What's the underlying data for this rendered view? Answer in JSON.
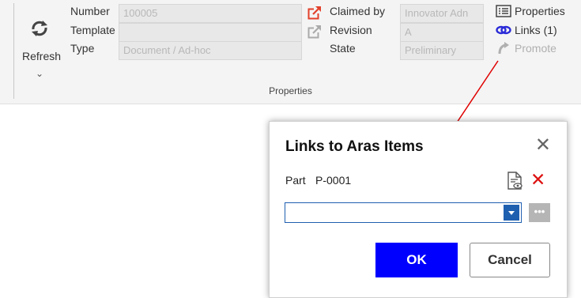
{
  "ribbon": {
    "refresh_label": "Refresh",
    "refresh_chevron": "⌄",
    "group_caption": "Properties",
    "fields": {
      "number": {
        "label": "Number",
        "value": "100005"
      },
      "template": {
        "label": "Template",
        "value": ""
      },
      "type": {
        "label": "Type",
        "value": "Document / Ad-hoc"
      },
      "claimed_by": {
        "label": "Claimed by",
        "value": "Innovator Adn"
      },
      "revision": {
        "label": "Revision",
        "value": "A"
      },
      "state": {
        "label": "State",
        "value": "Preliminary"
      }
    },
    "buttons": {
      "properties": "Properties",
      "links": "Links (1)",
      "promote": "Promote"
    }
  },
  "dialog": {
    "title": "Links to Aras Items",
    "close_glyph": "✕",
    "link_item": {
      "type": "Part",
      "value": "P-0001"
    },
    "delete_glyph": "✕",
    "combo_value": "",
    "ellipsis": "•••",
    "ok_label": "OK",
    "cancel_label": "Cancel"
  },
  "colors": {
    "accent_blue": "#0000ff",
    "combo_blue": "#1f5fb0",
    "external_link_red": "#e2402a",
    "arrow_red": "#e00000",
    "delete_red": "#dd1111"
  },
  "icons": [
    "refresh-icon",
    "external-link-icon",
    "list-icon",
    "links-icon",
    "promote-icon",
    "document-preview-icon",
    "close-icon",
    "delete-icon",
    "dropdown-icon",
    "ellipsis-icon"
  ]
}
